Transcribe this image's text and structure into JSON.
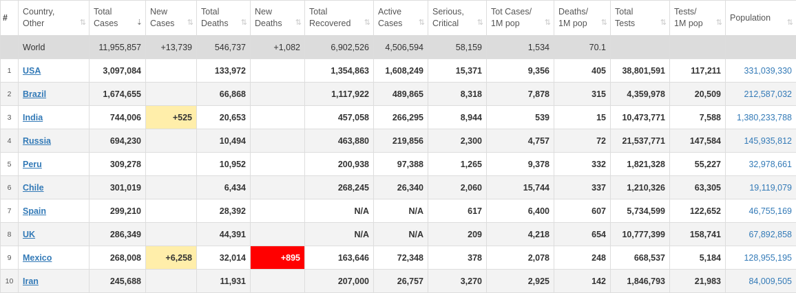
{
  "headers": [
    {
      "key": "num",
      "line1": "#",
      "line2": ""
    },
    {
      "key": "country",
      "line1": "Country,",
      "line2": "Other"
    },
    {
      "key": "total_cases",
      "line1": "Total",
      "line2": "Cases"
    },
    {
      "key": "new_cases",
      "line1": "New",
      "line2": "Cases"
    },
    {
      "key": "total_deaths",
      "line1": "Total",
      "line2": "Deaths"
    },
    {
      "key": "new_deaths",
      "line1": "New",
      "line2": "Deaths"
    },
    {
      "key": "total_recovered",
      "line1": "Total",
      "line2": "Recovered"
    },
    {
      "key": "active_cases",
      "line1": "Active",
      "line2": "Cases"
    },
    {
      "key": "serious_critical",
      "line1": "Serious,",
      "line2": "Critical"
    },
    {
      "key": "tot_cases_1m",
      "line1": "Tot Cases/",
      "line2": "1M pop"
    },
    {
      "key": "deaths_1m",
      "line1": "Deaths/",
      "line2": "1M pop"
    },
    {
      "key": "total_tests",
      "line1": "Total",
      "line2": "Tests"
    },
    {
      "key": "tests_1m",
      "line1": "Tests/",
      "line2": "1M pop"
    },
    {
      "key": "population",
      "line1": "Population",
      "line2": ""
    }
  ],
  "sort_icon": "⇅",
  "sort_active_icon": "⇣",
  "sorted_column": "total_cases",
  "colors": {
    "new_cases_highlight": "#ffeeaa",
    "new_deaths_highlight": "#ff0000",
    "link": "#337ab7",
    "world_row": "#dcdcdc"
  },
  "world": {
    "num": "",
    "country": "World",
    "total_cases": "11,955,857",
    "new_cases": "+13,739",
    "total_deaths": "546,737",
    "new_deaths": "+1,082",
    "total_recovered": "6,902,526",
    "active_cases": "4,506,594",
    "serious_critical": "58,159",
    "tot_cases_1m": "1,534",
    "deaths_1m": "70.1",
    "total_tests": "",
    "tests_1m": "",
    "population": ""
  },
  "rows": [
    {
      "num": "1",
      "country": "USA",
      "total_cases": "3,097,084",
      "new_cases": "",
      "total_deaths": "133,972",
      "new_deaths": "",
      "total_recovered": "1,354,863",
      "active_cases": "1,608,249",
      "serious_critical": "15,371",
      "tot_cases_1m": "9,356",
      "deaths_1m": "405",
      "total_tests": "38,801,591",
      "tests_1m": "117,211",
      "population": "331,039,330"
    },
    {
      "num": "2",
      "country": "Brazil",
      "total_cases": "1,674,655",
      "new_cases": "",
      "total_deaths": "66,868",
      "new_deaths": "",
      "total_recovered": "1,117,922",
      "active_cases": "489,865",
      "serious_critical": "8,318",
      "tot_cases_1m": "7,878",
      "deaths_1m": "315",
      "total_tests": "4,359,978",
      "tests_1m": "20,509",
      "population": "212,587,032"
    },
    {
      "num": "3",
      "country": "India",
      "total_cases": "744,006",
      "new_cases": "+525",
      "total_deaths": "20,653",
      "new_deaths": "",
      "total_recovered": "457,058",
      "active_cases": "266,295",
      "serious_critical": "8,944",
      "tot_cases_1m": "539",
      "deaths_1m": "15",
      "total_tests": "10,473,771",
      "tests_1m": "7,588",
      "population": "1,380,233,788"
    },
    {
      "num": "4",
      "country": "Russia",
      "total_cases": "694,230",
      "new_cases": "",
      "total_deaths": "10,494",
      "new_deaths": "",
      "total_recovered": "463,880",
      "active_cases": "219,856",
      "serious_critical": "2,300",
      "tot_cases_1m": "4,757",
      "deaths_1m": "72",
      "total_tests": "21,537,771",
      "tests_1m": "147,584",
      "population": "145,935,812"
    },
    {
      "num": "5",
      "country": "Peru",
      "total_cases": "309,278",
      "new_cases": "",
      "total_deaths": "10,952",
      "new_deaths": "",
      "total_recovered": "200,938",
      "active_cases": "97,388",
      "serious_critical": "1,265",
      "tot_cases_1m": "9,378",
      "deaths_1m": "332",
      "total_tests": "1,821,328",
      "tests_1m": "55,227",
      "population": "32,978,661"
    },
    {
      "num": "6",
      "country": "Chile",
      "total_cases": "301,019",
      "new_cases": "",
      "total_deaths": "6,434",
      "new_deaths": "",
      "total_recovered": "268,245",
      "active_cases": "26,340",
      "serious_critical": "2,060",
      "tot_cases_1m": "15,744",
      "deaths_1m": "337",
      "total_tests": "1,210,326",
      "tests_1m": "63,305",
      "population": "19,119,079"
    },
    {
      "num": "7",
      "country": "Spain",
      "total_cases": "299,210",
      "new_cases": "",
      "total_deaths": "28,392",
      "new_deaths": "",
      "total_recovered": "N/A",
      "active_cases": "N/A",
      "serious_critical": "617",
      "tot_cases_1m": "6,400",
      "deaths_1m": "607",
      "total_tests": "5,734,599",
      "tests_1m": "122,652",
      "population": "46,755,169"
    },
    {
      "num": "8",
      "country": "UK",
      "total_cases": "286,349",
      "new_cases": "",
      "total_deaths": "44,391",
      "new_deaths": "",
      "total_recovered": "N/A",
      "active_cases": "N/A",
      "serious_critical": "209",
      "tot_cases_1m": "4,218",
      "deaths_1m": "654",
      "total_tests": "10,777,399",
      "tests_1m": "158,741",
      "population": "67,892,858"
    },
    {
      "num": "9",
      "country": "Mexico",
      "total_cases": "268,008",
      "new_cases": "+6,258",
      "total_deaths": "32,014",
      "new_deaths": "+895",
      "total_recovered": "163,646",
      "active_cases": "72,348",
      "serious_critical": "378",
      "tot_cases_1m": "2,078",
      "deaths_1m": "248",
      "total_tests": "668,537",
      "tests_1m": "5,184",
      "population": "128,955,195"
    },
    {
      "num": "10",
      "country": "Iran",
      "total_cases": "245,688",
      "new_cases": "",
      "total_deaths": "11,931",
      "new_deaths": "",
      "total_recovered": "207,000",
      "active_cases": "26,757",
      "serious_critical": "3,270",
      "tot_cases_1m": "2,925",
      "deaths_1m": "142",
      "total_tests": "1,846,793",
      "tests_1m": "21,983",
      "population": "84,009,505"
    }
  ]
}
